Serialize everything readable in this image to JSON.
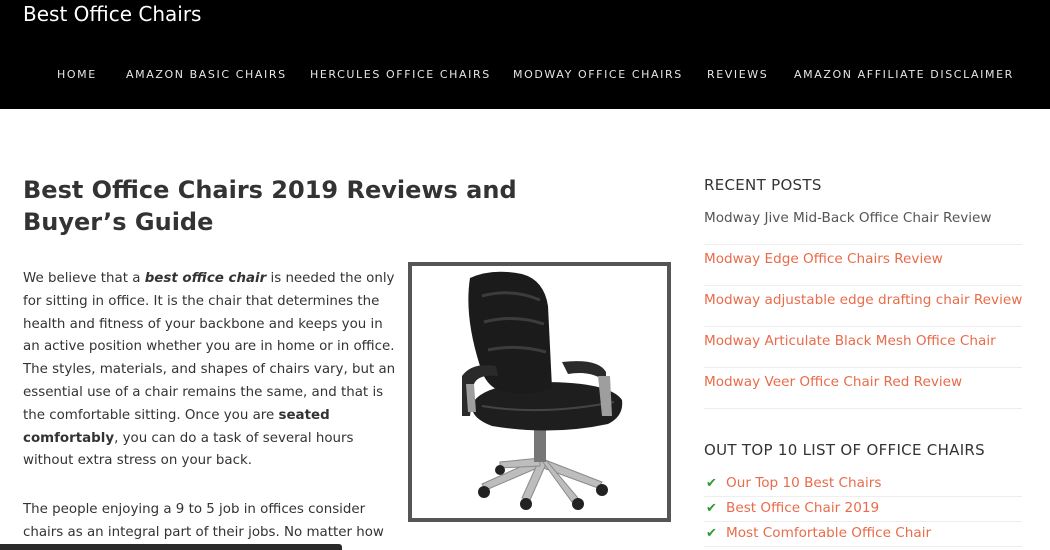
{
  "site": {
    "title": "Best Office Chairs"
  },
  "nav": {
    "items": [
      {
        "label": "HOME"
      },
      {
        "label": "AMAZON BASIC CHAIRS"
      },
      {
        "label": "HERCULES OFFICE CHAIRS"
      },
      {
        "label": "MODWAY OFFICE CHAIRS"
      },
      {
        "label": "REVIEWS"
      },
      {
        "label": "AMAZON AFFILIATE DISCLAIMER"
      }
    ]
  },
  "article": {
    "title": "Best Office Chairs 2019 Reviews and Buyer’s Guide",
    "p1": {
      "t1": "We believe that a ",
      "emph": "best office chair",
      "t2": " is needed the only for sitting in office. It is the chair that determines the health and fitness of your backbone and keeps you in an active position whether you are in home or in office. The styles, materials, and shapes of chairs vary, but an essential use of a chair remains the same, and that is the comfortable sitting. Once you are ",
      "strong": "seated comfortably",
      "t3": ", you can do a task of several hours without extra stress on your back."
    },
    "p2": "The people enjoying a 9 to 5 job in offices consider chairs as an integral part of their jobs. No matter how"
  },
  "sidebar": {
    "recent_title": "RECENT POSTS",
    "recent_posts": [
      {
        "label": "Modway Jive Mid-Back Office Chair Review",
        "color": "#555555"
      },
      {
        "label": "Modway Edge Office Chairs Review",
        "color": "#e96b4a"
      },
      {
        "label": "Modway adjustable edge drafting chair Review",
        "color": "#e96b4a"
      },
      {
        "label": "Modway Articulate Black Mesh Office Chair",
        "color": "#e96b4a"
      },
      {
        "label": "Modway Veer Office Chair Red Review",
        "color": "#e96b4a"
      }
    ],
    "top10_title": "OUT TOP 10 LIST OF OFFICE CHAIRS",
    "top10_items": [
      {
        "label": "Our Top 10 Best Chairs"
      },
      {
        "label": "Best Office Chair 2019"
      },
      {
        "label": "Most Comfortable Office Chair"
      }
    ],
    "link_color": "#e96b4a",
    "check_icon": "check-icon"
  }
}
